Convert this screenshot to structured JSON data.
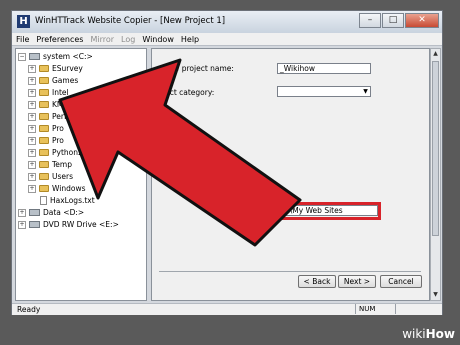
{
  "window": {
    "title": "WinHTTrack Website Copier - [New Project 1]",
    "app_icon_letter": "H",
    "controls": {
      "minimize": "–",
      "maximize": "□",
      "close": "✕"
    }
  },
  "menu": [
    {
      "label": "File",
      "enabled": true
    },
    {
      "label": "Preferences",
      "enabled": true
    },
    {
      "label": "Mirror",
      "enabled": false
    },
    {
      "label": "Log",
      "enabled": false
    },
    {
      "label": "Window",
      "enabled": true
    },
    {
      "label": "Help",
      "enabled": true
    }
  ],
  "tree": {
    "root": "system <C:>",
    "folders": [
      "ESurvey",
      "Games",
      "Intel",
      "KMPlayer",
      "Perfl",
      "Pro",
      "Pro",
      "Python2",
      "Temp",
      "Users",
      "Windows"
    ],
    "file": "HaxLogs.txt",
    "drives": [
      "Data <D:>",
      "DVD RW Drive <E:>"
    ]
  },
  "form": {
    "project_name_label": "New project name:",
    "project_name_value": "_Wikihow",
    "category_label": "ject category:",
    "category_value": "",
    "path_label": "ct",
    "path_value": "C:\\My Web Sites"
  },
  "buttons": {
    "back": "< Back",
    "next": "Next >",
    "cancel": "Cancel"
  },
  "status": {
    "text": "Ready",
    "num": "NUM"
  },
  "colors": {
    "arrow": "#d8232a",
    "highlight": "#d8232a"
  },
  "watermark": {
    "brand": "wiki",
    "suffix": "How"
  }
}
